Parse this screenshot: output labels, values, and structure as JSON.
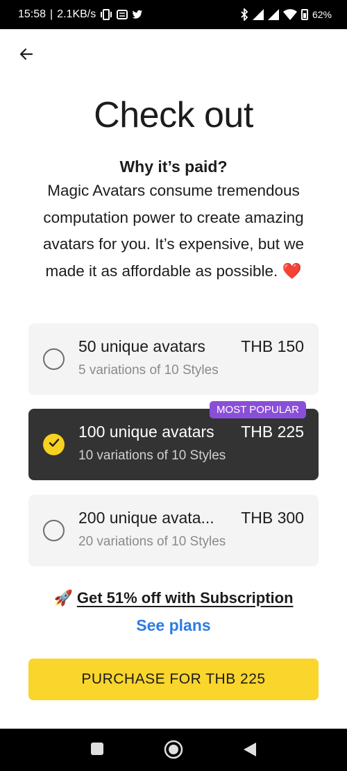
{
  "status_bar": {
    "time": "15:58",
    "network_speed": "2.1KB/s",
    "battery": "62%"
  },
  "page": {
    "title": "Check out",
    "why_heading": "Why it’s paid?",
    "description": "Magic Avatars consume tremendous computation power to create amazing avatars for you. It’s expensive, but we made it as affordable as possible. ❤️"
  },
  "plans": [
    {
      "name": "50 unique avatars",
      "price": "THB 150",
      "variations": "5 variations of 10 Styles",
      "selected": false
    },
    {
      "name": "100 unique avatars",
      "price": "THB 225",
      "variations": "10 variations of 10 Styles",
      "selected": true,
      "badge": "MOST POPULAR"
    },
    {
      "name": "200 unique avata...",
      "price": "THB 300",
      "variations": "20 variations of 10 Styles",
      "selected": false
    }
  ],
  "promo": {
    "icon": "rocket-icon",
    "text": "Get 51% off with Subscription",
    "link": "See plans"
  },
  "purchase_button": "PURCHASE FOR THB 225",
  "colors": {
    "accent_yellow": "#fad52c",
    "badge_purple": "#8a4fd8",
    "link_blue": "#2c7be5",
    "selected_card": "#333333",
    "card": "#f4f4f4"
  }
}
